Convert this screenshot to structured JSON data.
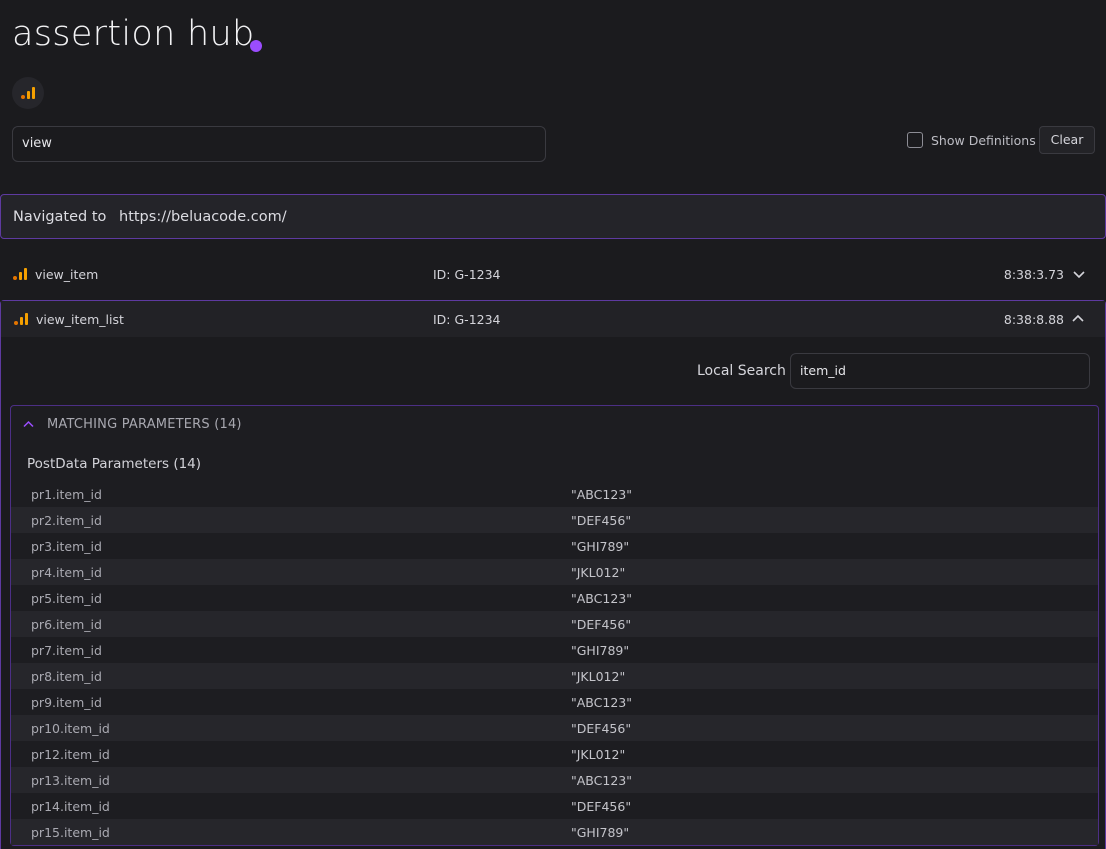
{
  "app": {
    "title": "assertion hub"
  },
  "search": {
    "value": "view"
  },
  "controls": {
    "show_definitions_label": "Show Definitions",
    "clear_label": "Clear"
  },
  "navigation": {
    "label": "Navigated to",
    "url": "https://beluacode.com/"
  },
  "events": [
    {
      "name": "view_item",
      "id": "ID: G-1234",
      "time": "8:38:3.73",
      "expanded": false
    },
    {
      "name": "view_item_list",
      "id": "ID: G-1234",
      "time": "8:38:8.88",
      "expanded": true
    }
  ],
  "detail": {
    "local_search_label": "Local Search",
    "local_search_value": "item_id",
    "matching_title": "MATCHING PARAMETERS (14)",
    "postdata_title": "PostData Parameters (14)",
    "params": [
      {
        "key": "pr1.item_id",
        "value": "\"ABC123\""
      },
      {
        "key": "pr2.item_id",
        "value": "\"DEF456\""
      },
      {
        "key": "pr3.item_id",
        "value": "\"GHI789\""
      },
      {
        "key": "pr4.item_id",
        "value": "\"JKL012\""
      },
      {
        "key": "pr5.item_id",
        "value": "\"ABC123\""
      },
      {
        "key": "pr6.item_id",
        "value": "\"DEF456\""
      },
      {
        "key": "pr7.item_id",
        "value": "\"GHI789\""
      },
      {
        "key": "pr8.item_id",
        "value": "\"JKL012\""
      },
      {
        "key": "pr9.item_id",
        "value": "\"ABC123\""
      },
      {
        "key": "pr10.item_id",
        "value": "\"DEF456\""
      },
      {
        "key": "pr12.item_id",
        "value": "\"JKL012\""
      },
      {
        "key": "pr13.item_id",
        "value": "\"ABC123\""
      },
      {
        "key": "pr14.item_id",
        "value": "\"DEF456\""
      },
      {
        "key": "pr15.item_id",
        "value": "\"GHI789\""
      }
    ]
  },
  "colors": {
    "accent": "#9b4dff",
    "border_accent": "#5e3aa0",
    "ga_orange": "#f5a000",
    "background": "#1b1b1e"
  },
  "icons": {
    "analytics": "analytics-bars-icon",
    "expand": "chevron-down-icon",
    "collapse": "chevron-up-icon"
  }
}
